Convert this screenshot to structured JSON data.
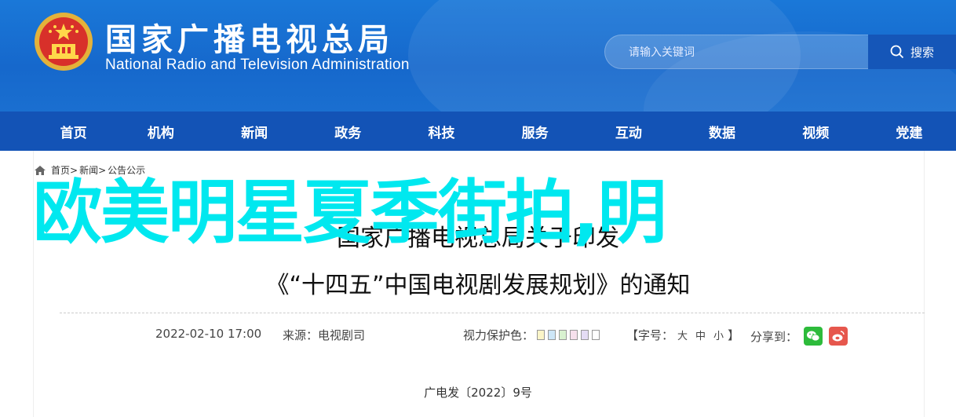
{
  "header": {
    "title_cn": "国家广播电视总局",
    "title_en": "National Radio and Television Administration",
    "search_placeholder": "请输入关键词",
    "search_button": "搜索"
  },
  "nav": [
    "首页",
    "机构",
    "新闻",
    "政务",
    "科技",
    "服务",
    "互动",
    "数据",
    "视频",
    "党建"
  ],
  "breadcrumb": [
    "首页>",
    "新闻>",
    "公告公示"
  ],
  "overlay_title": "欧美明星夏季街拍,明",
  "article": {
    "title_line1": "国家广播电视总局关于印发",
    "title_line2": "《“十四五”中国电视剧发展规划》的通知",
    "date": "2022-02-10 17:00",
    "source": "来源：电视剧司",
    "protect_label": "视力保护色：",
    "font_label_open": "【字号：",
    "font_sizes": [
      "大",
      "中",
      "小"
    ],
    "font_label_close": "】",
    "share_label": "分享到：",
    "doc_number": "广电发〔2022〕9号"
  },
  "colors": {
    "swatches": [
      "#fbf5c8",
      "#cde6f7",
      "#d8f2d0",
      "#f6e0ec",
      "#e4dcf4",
      "#ffffff"
    ],
    "overlay": "#00e8ef",
    "nav_bg": "#1353b6"
  }
}
